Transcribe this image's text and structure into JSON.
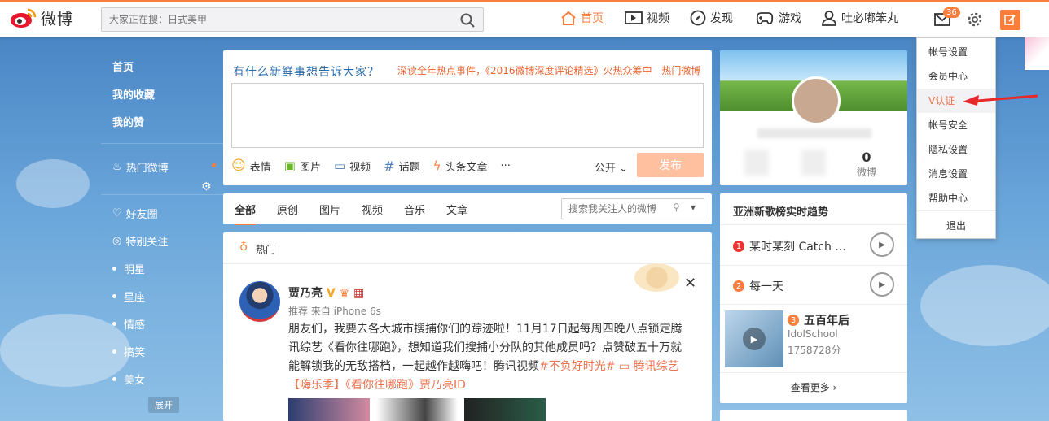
{
  "header": {
    "logo_text": "微博",
    "search_placeholder": "大家正在搜：日式美甲",
    "nav": [
      {
        "label": "首页"
      },
      {
        "label": "视频"
      },
      {
        "label": "发现"
      },
      {
        "label": "游戏"
      },
      {
        "label": "吐必嘟笨丸"
      }
    ],
    "message_count": "36",
    "accent": "#fa7d3c"
  },
  "sidebar": {
    "top_items": [
      "首页",
      "我的收藏",
      "我的赞"
    ],
    "hot": "热门微博",
    "groups": [
      "好友圈",
      "特别关注"
    ],
    "tags": [
      "明星",
      "星座",
      "情感",
      "搞笑",
      "美女"
    ],
    "expand": "展开"
  },
  "composer": {
    "prompt": "有什么新鲜事想告诉大家？",
    "hot_text": "深读全年热点事件，《2016微博深度评论精选》火热众筹中",
    "hot_link": "热门微博",
    "tools": [
      "表情",
      "图片",
      "视频",
      "话题",
      "头条文章",
      "···"
    ],
    "visibility": "公开",
    "publish": "发布"
  },
  "feed_tabs": {
    "tabs": [
      "全部",
      "原创",
      "图片",
      "视频",
      "音乐",
      "文章"
    ],
    "search_placeholder": "搜索我关注人的微博"
  },
  "feed": {
    "section": "热门",
    "post": {
      "user": "贾乃亮",
      "from": "推荐 来自 iPhone 6s",
      "text": "朋友们，我要去各大城市搜捕你们的踪迹啦！11月17日起每周四晚八点锁定腾讯综艺《看你往哪跑》，想知道我们搜捕小分队的其他成员吗？点赞破五十万就能解锁我的无敌搭档，一起越作越嗨吧！腾讯视频",
      "tag1": "#不负好时光#",
      "link1": "腾讯综艺【嗨乐季】《看你往哪跑》贾乃亮ID"
    }
  },
  "profile": {
    "stats": [
      {
        "n": "0",
        "l": "微博"
      }
    ]
  },
  "trend": {
    "title": "亚洲新歌榜实时趋势",
    "items": [
      {
        "rank": "1",
        "title": "某时某刻 Catch ..."
      },
      {
        "rank": "2",
        "title": "每一天"
      },
      {
        "rank": "3",
        "title": "五百年后",
        "artist": "IdolSchool",
        "score": "1758728分"
      }
    ],
    "more": "查看更多 ›"
  },
  "dropdown": {
    "items": [
      "帐号设置",
      "会员中心",
      "V认证",
      "帐号安全",
      "隐私设置",
      "消息设置",
      "帮助中心",
      "退出"
    ],
    "active_index": 2
  }
}
